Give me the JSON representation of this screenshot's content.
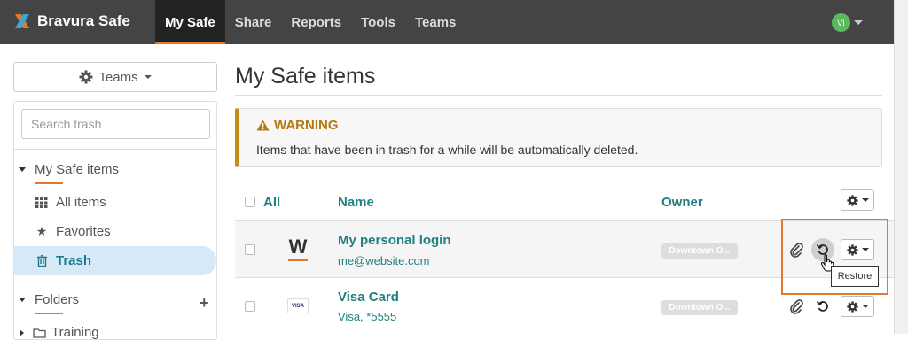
{
  "brand": {
    "name": "Bravura Safe",
    "accent": "#e8772e"
  },
  "nav": {
    "items": [
      {
        "label": "My Safe",
        "active": true
      },
      {
        "label": "Share"
      },
      {
        "label": "Reports"
      },
      {
        "label": "Tools"
      },
      {
        "label": "Teams"
      }
    ]
  },
  "user": {
    "initials": "VI"
  },
  "sidebar": {
    "teams_button": "Teams",
    "search_placeholder": "Search trash",
    "my_safe_header": "My Safe items",
    "items": [
      {
        "label": "All items",
        "icon": "grid-icon"
      },
      {
        "label": "Favorites",
        "icon": "star-icon"
      },
      {
        "label": "Trash",
        "icon": "trash-icon",
        "active": true
      }
    ],
    "folders_header": "Folders",
    "folder_partial": "Training"
  },
  "main": {
    "title": "My Safe items",
    "warning": {
      "title": "WARNING",
      "text": "Items that have been in trash for a while will be automatically deleted."
    },
    "table": {
      "headers": {
        "all": "All",
        "name": "Name",
        "owner": "Owner"
      },
      "rows": [
        {
          "name": "My personal login",
          "sub": "me@website.com",
          "owner": "Downtown O...",
          "logo": "W"
        },
        {
          "name": "Visa Card",
          "sub": "Visa, *5555",
          "owner": "Downtown O...",
          "logo": "VISA"
        }
      ]
    },
    "tooltip": "Restore"
  }
}
